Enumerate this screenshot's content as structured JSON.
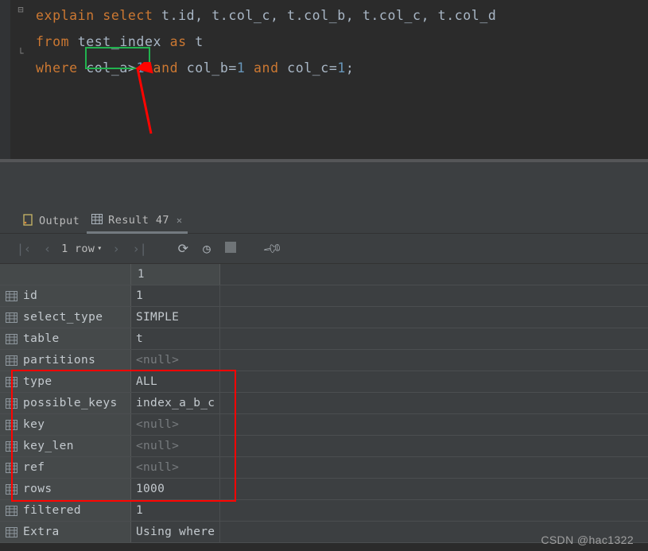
{
  "sql": {
    "line1": {
      "explain": "explain",
      "select": "select",
      "expr": "t.id, t.col_c, t.col_b, t.col_c, t.col_d"
    },
    "line2": {
      "from": "from",
      "table": "test_index",
      "as": "as",
      "alias": "t"
    },
    "line3": {
      "where": "where",
      "c1": "col_a",
      "op1": ">",
      "v1": "1",
      "and1": "and",
      "c2": "col_b",
      "eq": "=",
      "v2": "1",
      "and2": "and",
      "c3": "col_c",
      "v3": "1",
      "semi": ";"
    }
  },
  "tabs": {
    "output": "Output",
    "result": "Result 47"
  },
  "toolbar": {
    "rows": "1 row"
  },
  "grid": {
    "header": "1",
    "rows": [
      {
        "k": "id",
        "v": "1",
        "null": false
      },
      {
        "k": "select_type",
        "v": "SIMPLE",
        "null": false
      },
      {
        "k": "table",
        "v": "t",
        "null": false
      },
      {
        "k": "partitions",
        "v": "<null>",
        "null": true
      },
      {
        "k": "type",
        "v": "ALL",
        "null": false
      },
      {
        "k": "possible_keys",
        "v": "index_a_b_c",
        "null": false
      },
      {
        "k": "key",
        "v": "<null>",
        "null": true
      },
      {
        "k": "key_len",
        "v": "<null>",
        "null": true
      },
      {
        "k": "ref",
        "v": "<null>",
        "null": true
      },
      {
        "k": "rows",
        "v": "1000",
        "null": false
      },
      {
        "k": "filtered",
        "v": "1",
        "null": false
      },
      {
        "k": "Extra",
        "v": "Using where",
        "null": false
      }
    ]
  },
  "watermark": "CSDN @hac1322"
}
